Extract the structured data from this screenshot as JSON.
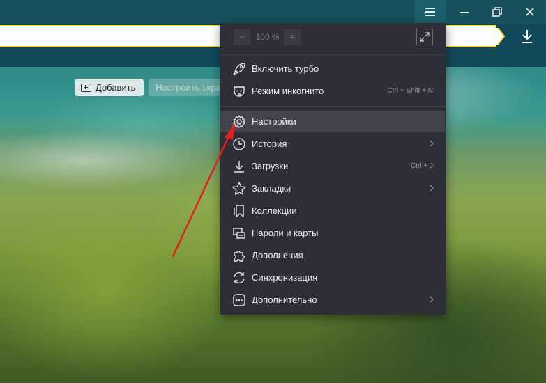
{
  "window": {
    "menu_icon": "hamburger-icon",
    "minimize_icon": "minimize-icon",
    "maximize_icon": "restore-icon",
    "close_icon": "close-icon"
  },
  "address_bar": {
    "value": "",
    "download_icon": "download-icon",
    "accent_color": "#f3d23b"
  },
  "page": {
    "add_button_label": "Добавить",
    "customize_button_label": "Настроить экра"
  },
  "menu": {
    "zoom": {
      "minus_label": "−",
      "value": "100 %",
      "plus_label": "+"
    },
    "items": [
      {
        "label": "Включить турбо",
        "icon": "rocket-icon",
        "shortcut": "",
        "has_submenu": false
      },
      {
        "label": "Режим инкогнито",
        "icon": "incognito-mask-icon",
        "shortcut": "Ctrl + Shift + N",
        "has_submenu": false
      },
      {
        "label": "Настройки",
        "icon": "gear-icon",
        "shortcut": "",
        "has_submenu": false
      },
      {
        "label": "История",
        "icon": "clock-icon",
        "shortcut": "",
        "has_submenu": true
      },
      {
        "label": "Загрузки",
        "icon": "download-icon",
        "shortcut": "Ctrl + J",
        "has_submenu": false
      },
      {
        "label": "Закладки",
        "icon": "star-icon",
        "shortcut": "",
        "has_submenu": true
      },
      {
        "label": "Коллекции",
        "icon": "collections-icon",
        "shortcut": "",
        "has_submenu": false
      },
      {
        "label": "Пароли и карты",
        "icon": "key-card-icon",
        "shortcut": "",
        "has_submenu": false
      },
      {
        "label": "Дополнения",
        "icon": "puzzle-icon",
        "shortcut": "",
        "has_submenu": false
      },
      {
        "label": "Синхронизация",
        "icon": "sync-icon",
        "shortcut": "",
        "has_submenu": false
      },
      {
        "label": "Дополнительно",
        "icon": "more-dots-icon",
        "shortcut": "",
        "has_submenu": true
      }
    ]
  },
  "colors": {
    "menu_bg": "#2e2e36",
    "highlight": "#43434c",
    "annotation_arrow": "#e0201e"
  }
}
